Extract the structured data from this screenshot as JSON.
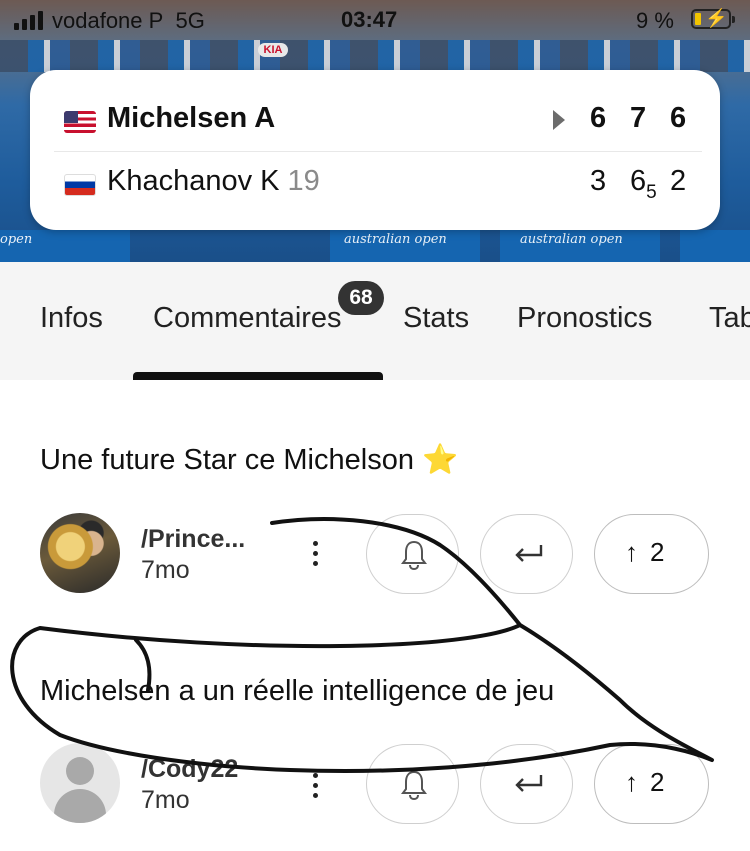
{
  "status_bar": {
    "carrier": "vodafone P",
    "network": "5G",
    "time": "03:47",
    "battery_percent": "9 %",
    "battery_level": 0.09,
    "charging": true
  },
  "hero": {
    "sponsor": "KIA",
    "banner_texts": [
      "australian open",
      "australian open",
      "australian open",
      "open"
    ]
  },
  "match": {
    "players": [
      {
        "flag": "us-flag",
        "name": "Michelsen A",
        "seed": "",
        "serving": true,
        "winner": true,
        "sets": [
          "6",
          "7",
          "6"
        ],
        "tiebreaks": [
          "",
          "",
          ""
        ]
      },
      {
        "flag": "ru-flag",
        "name": "Khachanov K",
        "seed": "19",
        "serving": false,
        "winner": false,
        "sets": [
          "3",
          "6",
          "2"
        ],
        "tiebreaks": [
          "",
          "5",
          ""
        ]
      }
    ]
  },
  "tabs": {
    "items": [
      "Infos",
      "Commentaires",
      "Stats",
      "Pronostics",
      "Tab"
    ],
    "active_index": 1,
    "comment_count": "68"
  },
  "comments": [
    {
      "text": "Une future Star ce Michelson ⭐",
      "username": "/Prince...",
      "time": "7mo",
      "upvotes": "2",
      "avatar": "trophy-photo"
    },
    {
      "text": "Michelsen a un réelle intelligence de jeu",
      "username": "/Cody22",
      "time": "7mo",
      "upvotes": "2",
      "avatar": "default-avatar"
    }
  ],
  "icons": {
    "more": "kebab-icon",
    "notify": "bell-icon",
    "reply": "reply-icon",
    "upvote": "arrow-up-icon"
  },
  "colors": {
    "tab_indicator": "#111111",
    "badge": "#333333",
    "tab_bar_bg": "#f5f5f5"
  }
}
